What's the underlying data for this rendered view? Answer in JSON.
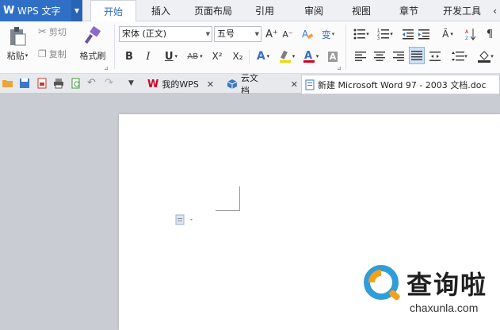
{
  "app": {
    "name": "WPS 文字",
    "logo": "W"
  },
  "menu": {
    "tabs": [
      {
        "label": "开始",
        "active": true
      },
      {
        "label": "插入"
      },
      {
        "label": "页面布局"
      },
      {
        "label": "引用"
      },
      {
        "label": "审阅"
      },
      {
        "label": "视图"
      },
      {
        "label": "章节"
      },
      {
        "label": "开发工具"
      }
    ]
  },
  "ribbon": {
    "paste_label": "粘贴",
    "cut_label": "剪切",
    "copy_label": "复制",
    "format_painter_label": "格式刷",
    "font_name": "宋体 (正文)",
    "font_size": "五号",
    "bold": "B",
    "italic": "I",
    "underline": "U",
    "strike": "AB",
    "superscript": "X²",
    "subscript": "X₂",
    "grow_font": "A⁺",
    "shrink_font": "A⁻",
    "phonetic": "变",
    "font_color_letter": "A",
    "char_shade": "A",
    "accent_color": "#2f6fc6",
    "highlight_color": "#f2d600",
    "font_color": "#d0021b"
  },
  "quickbar": {
    "tabs": [
      {
        "label": "我的WPS",
        "icon": "wps-logo-icon"
      },
      {
        "label": "云文档",
        "icon": "cube-icon"
      },
      {
        "label": "新建 Microsoft Word 97 - 2003 文档.doc",
        "icon": "doc-icon",
        "active": true
      }
    ]
  },
  "watermark": {
    "title": "查询啦",
    "url": "chaxunla.com"
  }
}
